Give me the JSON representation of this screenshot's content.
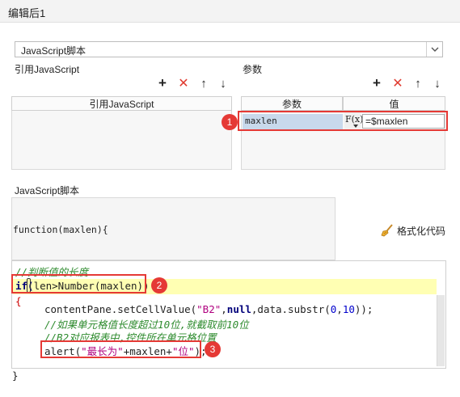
{
  "window": {
    "title": "编辑后1"
  },
  "script_type": {
    "value": "JavaScript脚本"
  },
  "ref_section": {
    "label": "引用JavaScript",
    "column_header": "引用JavaScript"
  },
  "param_section": {
    "label": "参数",
    "col_name": "参数",
    "col_value": "值",
    "row": {
      "name": "maxlen",
      "fx": "F(x)",
      "value": "=$maxlen"
    }
  },
  "script_section": {
    "label": "JavaScript脚本",
    "signature": "function(maxlen){"
  },
  "format_button": {
    "label": "格式化代码"
  },
  "code": {
    "l1": "//判断值的长度",
    "l2a": "if(",
    "l2b": "len>Number(maxlen))",
    "l3": "{",
    "l4a": "contentPane.setCellValue(",
    "l4s": "\"B2\"",
    "l4c": ",",
    "l4k": "null",
    "l4d": ",data.substr(",
    "l4n1": "0",
    "l4e": ",",
    "l4n2": "10",
    "l4f": "));",
    "l5": "//如果单元格值长度超过10位,就截取前10位",
    "l6": "//B2对应报表中,控件所在单元格位置",
    "l7a": "alert(",
    "l7s1": "\"最长为\"",
    "l7b": "+maxlen+",
    "l7s2": "\"位\"",
    "l7c": ");",
    "closing": "}"
  },
  "badges": {
    "b1": "1",
    "b2": "2",
    "b3": "3"
  },
  "icons": {
    "add": "+",
    "delete": "✕",
    "up": "↑",
    "down": "↓",
    "dropdown": "chevron-down-icon",
    "format": "broom-icon"
  },
  "colors": {
    "highlight": "#e53935",
    "delete": "#e03a2f",
    "selected_row": "#c8d9ec"
  }
}
